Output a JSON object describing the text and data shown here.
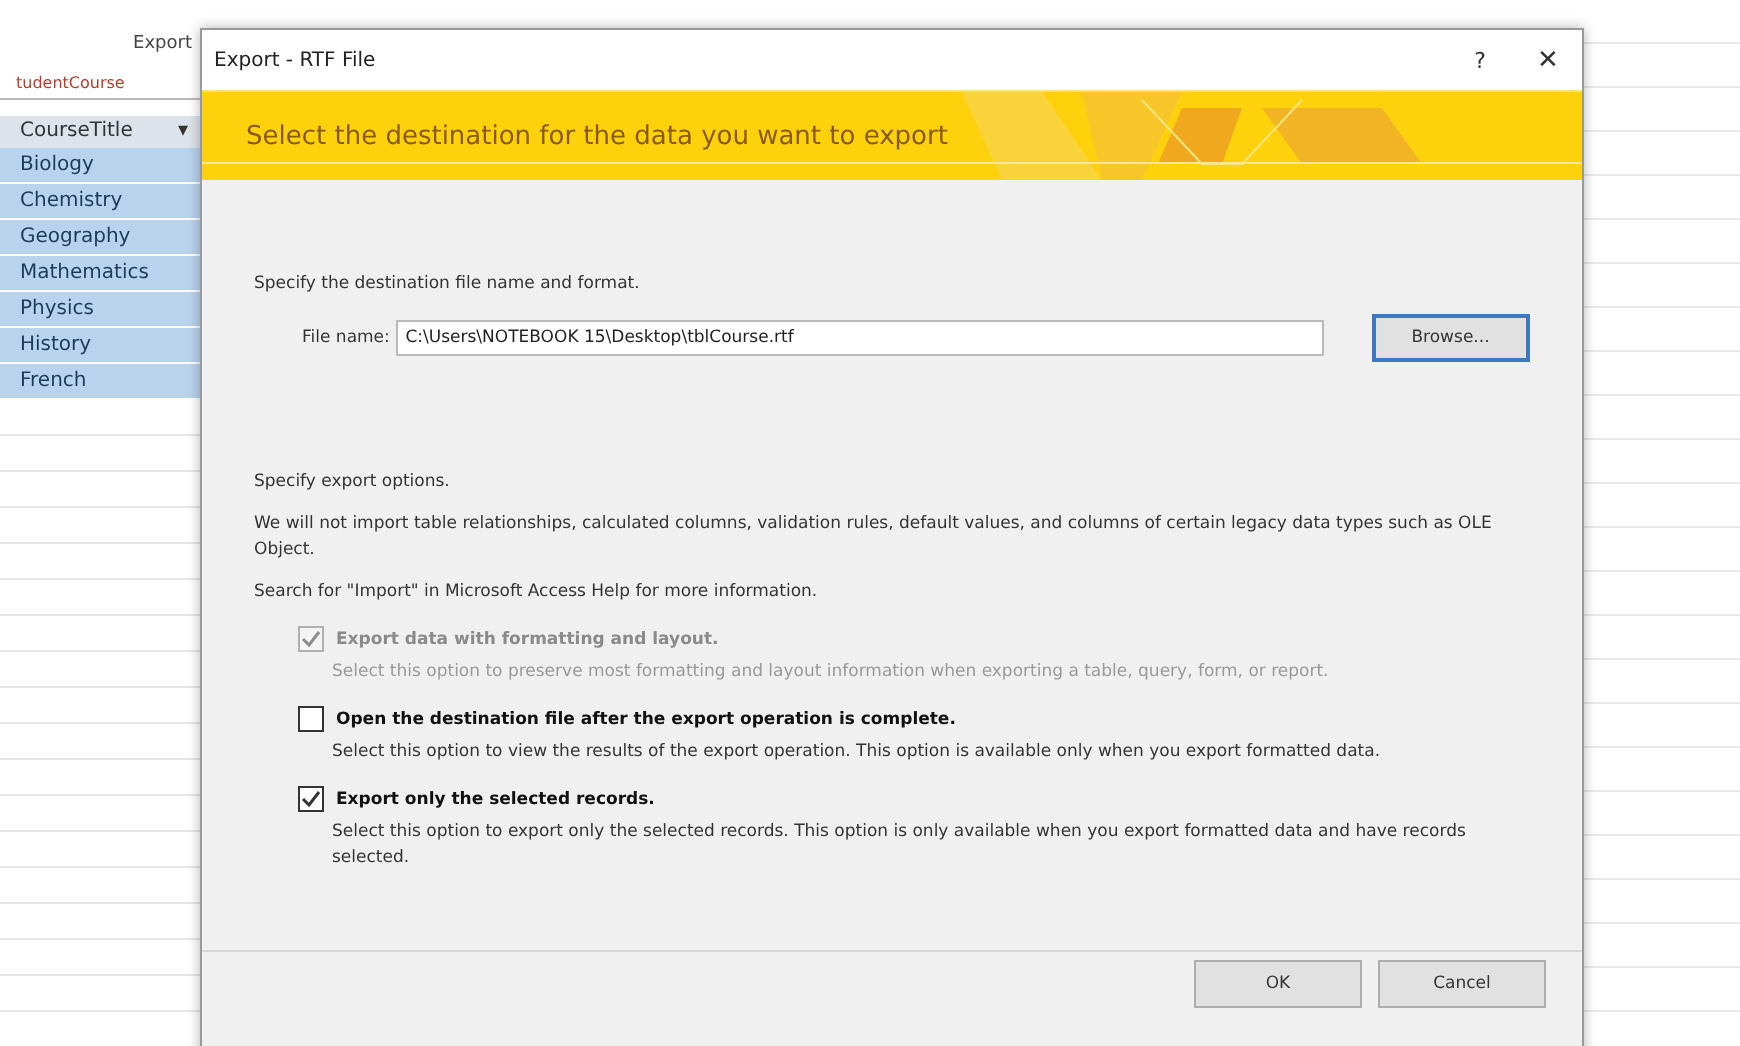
{
  "background": {
    "ribbon_label": "Export",
    "tab": "tudentCourse",
    "column_header": "CourseTitle",
    "sort_glyph": "▾",
    "rows": [
      {
        "label": "Biology",
        "selected": true
      },
      {
        "label": "Chemistry",
        "selected": true
      },
      {
        "label": "Geography",
        "selected": true
      },
      {
        "label": "Mathematics",
        "selected": true
      },
      {
        "label": "Physics",
        "selected": true
      },
      {
        "label": "History",
        "selected": true
      },
      {
        "label": "French",
        "selected": true
      }
    ]
  },
  "dialog": {
    "title": "Export - RTF File",
    "help": "?",
    "close": "✕",
    "banner": "Select the destination for the data you want to export",
    "destination_intro": "Specify the destination file name and format.",
    "file_label": "File name:",
    "file_value": "C:\\Users\\NOTEBOOK 15\\Desktop\\tblCourse.rtf",
    "browse": "Browse...",
    "options_intro": "Specify export options.",
    "notice": "We will not import table relationships, calculated columns, validation rules, default values, and columns of certain legacy data types such as OLE Object.",
    "help_hint": "Search for \"Import\" in Microsoft Access Help for more information.",
    "options": [
      {
        "label": "Export data with formatting and layout.",
        "description": "Select this option to preserve most formatting and layout information when exporting a table, query, form, or report.",
        "checked": true,
        "disabled": true
      },
      {
        "label": "Open the destination file after the export operation is complete.",
        "description": "Select this option to view the results of the export operation. This option is available only when you export formatted data.",
        "checked": false,
        "disabled": false
      },
      {
        "label": "Export only the selected records.",
        "description": "Select this option to export only the selected records. This option is only available when you export formatted data and have records selected.",
        "checked": true,
        "disabled": false
      }
    ],
    "buttons": [
      "OK",
      "Cancel"
    ]
  }
}
